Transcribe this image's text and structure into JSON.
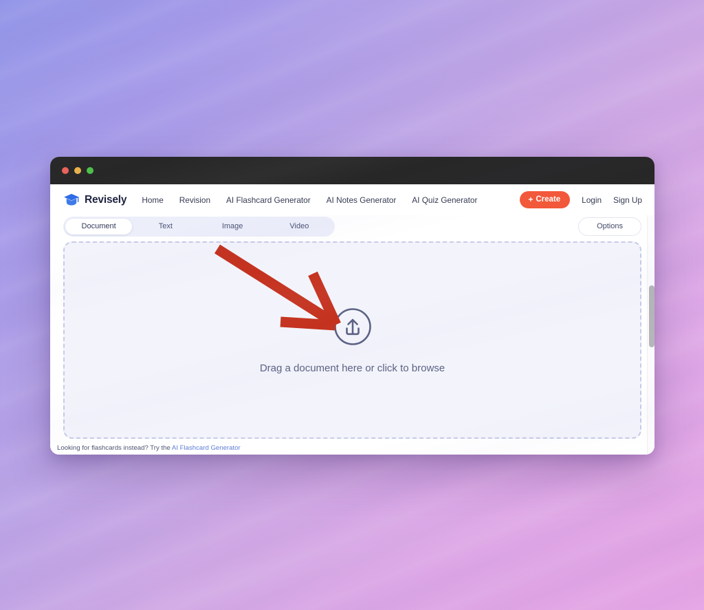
{
  "window": {
    "traffic_lights": [
      "close",
      "minimize",
      "maximize"
    ]
  },
  "nav": {
    "brand": {
      "name": "Revisely",
      "logo_icon": "graduation-cap-icon",
      "logo_color": "#2f6ce5"
    },
    "links": [
      {
        "label": "Home"
      },
      {
        "label": "Revision"
      },
      {
        "label": "AI Flashcard Generator"
      },
      {
        "label": "AI Notes Generator"
      },
      {
        "label": "AI Quiz Generator"
      }
    ],
    "create_button": {
      "label": "Create",
      "plus": "+",
      "color": "#f2583a"
    },
    "login_label": "Login",
    "signup_label": "Sign Up"
  },
  "tabs": {
    "items": [
      {
        "label": "Document",
        "active": true
      },
      {
        "label": "Text",
        "active": false
      },
      {
        "label": "Image",
        "active": false
      },
      {
        "label": "Video",
        "active": false
      }
    ],
    "options_label": "Options"
  },
  "dropzone": {
    "icon": "upload-circle-icon",
    "text": "Drag a document here or click to browse",
    "border_style": "dashed",
    "border_color": "#c6cbe6",
    "fill_color": "#f3f4fb"
  },
  "footer": {
    "prefix": "Looking for flashcards instead? Try the ",
    "link_label": "AI Flashcard Generator",
    "link_color": "#5b7ad6"
  },
  "annotation": {
    "type": "arrow",
    "color": "#c4321f",
    "points_to": "upload-circle-icon"
  },
  "desktop": {
    "gradient_from": "#9396e8",
    "gradient_to": "#e5a3e4"
  }
}
